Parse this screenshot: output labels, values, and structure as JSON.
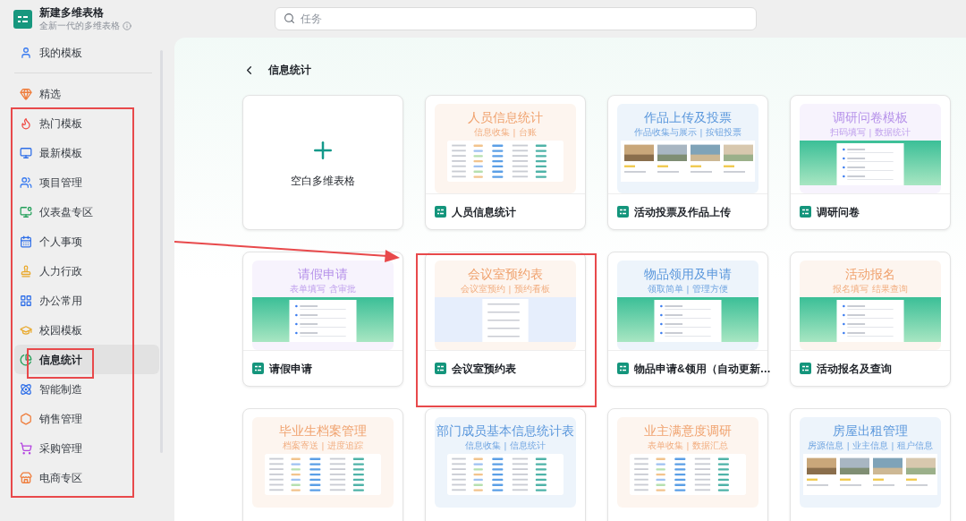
{
  "app": {
    "title": "新建多维表格",
    "subtitle": "全新一代的多维表格"
  },
  "search": {
    "placeholder": "任务"
  },
  "sidebar": {
    "items": [
      {
        "label": "我的模板",
        "selected": false
      },
      {
        "label": "精选",
        "selected": false
      },
      {
        "label": "热门模板",
        "selected": false
      },
      {
        "label": "最新模板",
        "selected": false
      },
      {
        "label": "项目管理",
        "selected": false
      },
      {
        "label": "仪表盘专区",
        "selected": false
      },
      {
        "label": "个人事项",
        "selected": false
      },
      {
        "label": "人力行政",
        "selected": false
      },
      {
        "label": "办公常用",
        "selected": false
      },
      {
        "label": "校园模板",
        "selected": false
      },
      {
        "label": "信息统计",
        "selected": true
      },
      {
        "label": "智能制造",
        "selected": false
      },
      {
        "label": "销售管理",
        "selected": false
      },
      {
        "label": "采购管理",
        "selected": false
      },
      {
        "label": "电商专区",
        "selected": false
      }
    ]
  },
  "page": {
    "title": "信息统计"
  },
  "blank_card": {
    "label": "空白多维表格"
  },
  "templates": [
    {
      "name": "人员信息统计",
      "thumb": {
        "title": "人员信息统计",
        "subtitle": "信息收集 | 台账",
        "color": "#f0a26e",
        "kind": "table"
      }
    },
    {
      "name": "活动投票及作品上传",
      "thumb": {
        "title": "作品上传及投票",
        "subtitle": "作品收集与展示 | 按钮投票",
        "color": "#5a97dc",
        "kind": "gallery"
      }
    },
    {
      "name": "调研问卷",
      "thumb": {
        "title": "调研问卷模板",
        "subtitle": "扫码填写 | 数据统计",
        "color": "#b692ea",
        "kind": "form"
      }
    },
    {
      "name": "请假申请",
      "thumb": {
        "title": "请假申请",
        "subtitle": "表单填写  含审批",
        "color": "#b692ea",
        "kind": "form"
      }
    },
    {
      "name": "会议室预约表",
      "thumb": {
        "title": "会议室预约表",
        "subtitle": "会议室预约 | 预约看板",
        "color": "#f0a26e",
        "kind": "sheet"
      }
    },
    {
      "name": "物品申请&领用（自动更新…",
      "thumb": {
        "title": "物品领用及申请",
        "subtitle": "领取简单 | 管理方便",
        "color": "#5a97dc",
        "kind": "form"
      }
    },
    {
      "name": "活动报名及查询",
      "thumb": {
        "title": "活动报名",
        "subtitle": "报名填写  结果查询",
        "color": "#f0a26e",
        "kind": "form"
      }
    },
    {
      "thumb": {
        "title": "毕业生档案管理",
        "subtitle": "档案寄送 | 进度追踪",
        "color": "#f0a26e",
        "kind": "table"
      }
    },
    {
      "thumb": {
        "title": "部门成员基本信息统计表",
        "subtitle": "信息收集 | 信息统计",
        "color": "#5a97dc",
        "kind": "table"
      }
    },
    {
      "thumb": {
        "title": "业主满意度调研",
        "subtitle": "表单收集 | 数据汇总",
        "color": "#f0a26e",
        "kind": "table"
      }
    },
    {
      "thumb": {
        "title": "房屋出租管理",
        "subtitle": "房源信息 | 业主信息 | 租户信息",
        "color": "#5a97dc",
        "kind": "gallery"
      }
    }
  ],
  "annotations": [
    {
      "kind": "box"
    },
    {
      "kind": "box"
    },
    {
      "kind": "arrow"
    },
    {
      "kind": "box"
    }
  ]
}
